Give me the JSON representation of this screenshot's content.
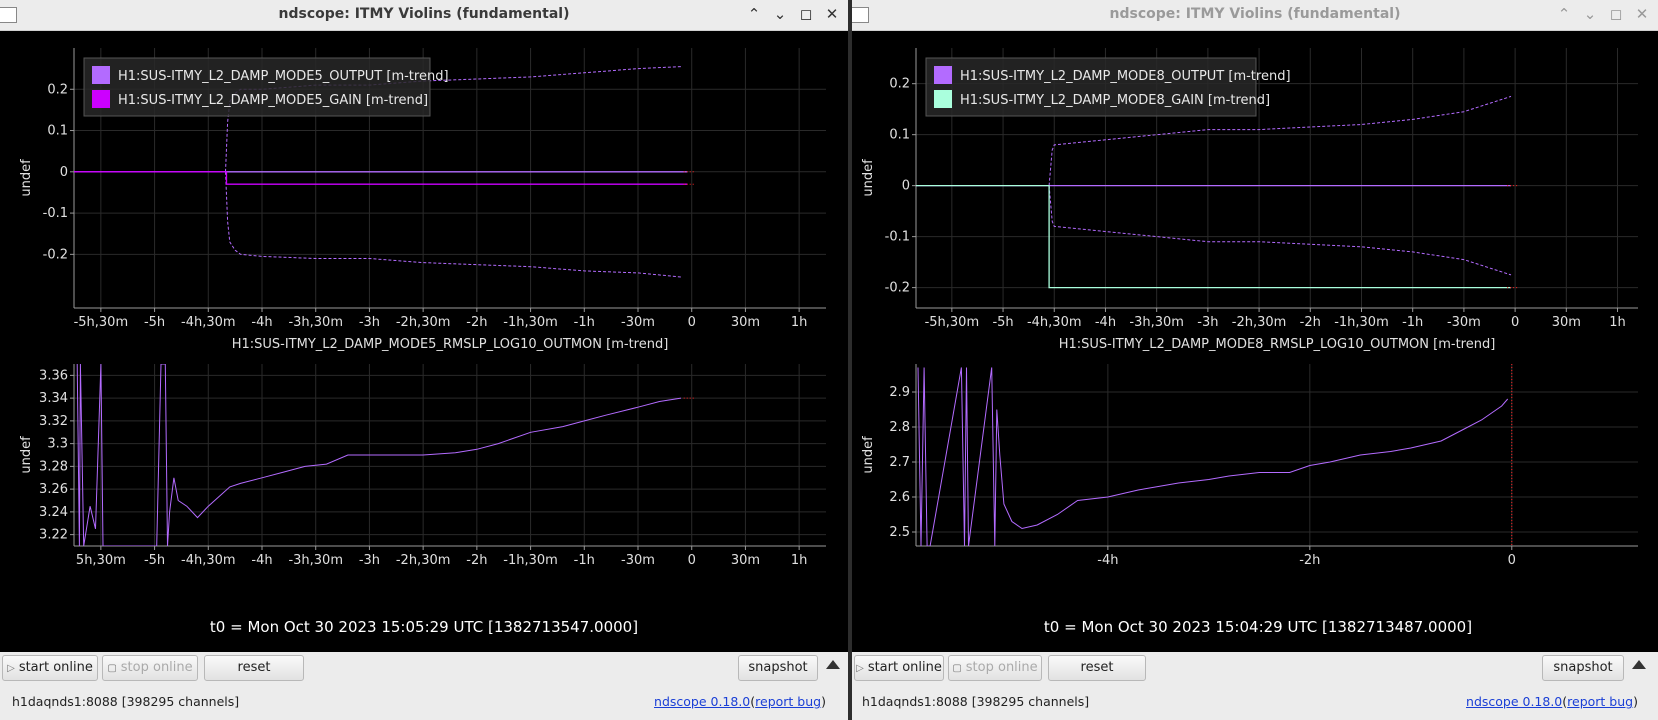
{
  "windows": [
    {
      "title": "ndscope: ITMY Violins (fundamental)",
      "t0": "t0 = Mon Oct 30 2023 15:05:29 UTC [1382713547.0000]",
      "toolbar": {
        "start_online": "start online",
        "stop_online": "stop online",
        "reset": "reset",
        "snapshot": "snapshot"
      },
      "status": {
        "host": "h1daqnds1:8088  [398295 channels]",
        "version_link": "ndscope 0.18.0",
        "paren_open": "(",
        "report_link": "report bug",
        "paren_close": ")"
      }
    },
    {
      "title": "ndscope: ITMY Violins (fundamental)",
      "t0": "t0 = Mon Oct 30 2023 15:04:29 UTC [1382713487.0000]",
      "toolbar": {
        "start_online": "start online",
        "stop_online": "stop online",
        "reset": "reset",
        "snapshot": "snapshot"
      },
      "status": {
        "host": "h1daqnds1:8088  [398295 channels]",
        "version_link": "ndscope 0.18.0",
        "paren_open": "(",
        "report_link": "report bug",
        "paren_close": ")"
      }
    }
  ],
  "colors": {
    "purple": "#cc00ff",
    "lavender": "#b36bff",
    "mint": "#aaffdd",
    "red_marker": "#ff2222",
    "grid": "#2a2a2a",
    "axis": "#9a9a9a"
  },
  "chart_data": [
    {
      "type": "line",
      "title": "",
      "ylabel": "undef",
      "xlim": [
        -5.75,
        1.25
      ],
      "ylim": [
        -0.33,
        0.3
      ],
      "xticks": [
        -5.5,
        -5,
        -4.5,
        -4,
        -3.5,
        -3,
        -2.5,
        -2,
        -1.5,
        -1,
        -0.5,
        0,
        0.5,
        1
      ],
      "xtick_labels": [
        "-5h,30m",
        "-5h",
        "-4h,30m",
        "-4h",
        "-3h,30m",
        "-3h",
        "-2h,30m",
        "-2h",
        "-1h,30m",
        "-1h",
        "-30m",
        "0",
        "30m",
        "1h"
      ],
      "yticks": [
        -0.2,
        -0.1,
        0,
        0.1,
        0.2
      ],
      "ytick_labels": [
        "-0.2",
        "-0.1",
        "0",
        "0.1",
        "0.2"
      ],
      "legend": "top-left",
      "series": [
        {
          "name": "H1:SUS-ITMY_L2_DAMP_MODE5_OUTPUT [m-trend]",
          "color": "#b36bff",
          "style": "mean",
          "x": [
            -5.75,
            -0.04
          ],
          "y": [
            0.0,
            0.0
          ]
        },
        {
          "name": "H1:SUS-ITMY_L2_DAMP_MODE5_OUTPUT [m-trend]",
          "color": "#b36bff",
          "style": "envelope-max",
          "x": [
            -4.34,
            -4.32,
            -4.3,
            -4.25,
            -4.2,
            -4.0,
            -3.5,
            -3.0,
            -2.5,
            -2.0,
            -1.5,
            -1.0,
            -0.5,
            -0.1
          ],
          "y": [
            0.0,
            0.12,
            0.17,
            0.19,
            0.2,
            0.2,
            0.21,
            0.21,
            0.22,
            0.225,
            0.23,
            0.24,
            0.25,
            0.255
          ]
        },
        {
          "name": "H1:SUS-ITMY_L2_DAMP_MODE5_OUTPUT [m-trend]",
          "color": "#b36bff",
          "style": "envelope-min",
          "x": [
            -4.34,
            -4.32,
            -4.3,
            -4.25,
            -4.2,
            -4.0,
            -3.5,
            -3.0,
            -2.5,
            -2.0,
            -1.5,
            -1.0,
            -0.5,
            -0.1
          ],
          "y": [
            0.0,
            -0.12,
            -0.17,
            -0.19,
            -0.2,
            -0.205,
            -0.21,
            -0.21,
            -0.22,
            -0.225,
            -0.23,
            -0.24,
            -0.245,
            -0.255
          ]
        },
        {
          "name": "H1:SUS-ITMY_L2_DAMP_MODE5_GAIN [m-trend]",
          "color": "#cc00ff",
          "style": "mean",
          "x": [
            -5.75,
            -4.33,
            -4.33,
            -0.04
          ],
          "y": [
            0.0,
            0.0,
            -0.03,
            -0.03
          ]
        }
      ]
    },
    {
      "type": "line",
      "title": "H1:SUS-ITMY_L2_DAMP_MODE5_RMSLP_LOG10_OUTMON [m-trend]",
      "ylabel": "undef",
      "xlim": [
        -5.75,
        1.25
      ],
      "ylim": [
        3.21,
        3.37
      ],
      "xticks": [
        -5.5,
        -5,
        -4.5,
        -4,
        -3.5,
        -3,
        -2.5,
        -2,
        -1.5,
        -1,
        -0.5,
        0,
        0.5,
        1
      ],
      "xtick_labels": [
        "5h,30m",
        "-5h",
        "-4h,30m",
        "-4h",
        "-3h,30m",
        "-3h",
        "-2h,30m",
        "-2h",
        "-1h,30m",
        "-1h",
        "-30m",
        "0",
        "30m",
        "1h"
      ],
      "yticks": [
        3.22,
        3.24,
        3.26,
        3.28,
        3.3,
        3.32,
        3.34,
        3.36
      ],
      "ytick_labels": [
        "3.22",
        "3.24",
        "3.26",
        "3.28",
        "3.3",
        "3.32",
        "3.34",
        "3.36"
      ],
      "series": [
        {
          "name": "H1:SUS-ITMY_L2_DAMP_MODE5_RMSLP_LOG10_OUTMON [m-trend]",
          "color": "#b36bff",
          "x": [
            -5.72,
            -5.7,
            -5.69,
            -5.66,
            -5.6,
            -5.55,
            -5.5,
            -5.48,
            -4.98,
            -4.94,
            -4.9,
            -4.88,
            -4.86,
            -4.82,
            -4.78,
            -4.7,
            -4.6,
            -4.5,
            -4.3,
            -4.2,
            -4.0,
            -3.8,
            -3.6,
            -3.4,
            -3.2,
            -3.0,
            -2.8,
            -2.5,
            -2.2,
            -2.0,
            -1.8,
            -1.5,
            -1.2,
            -1.0,
            -0.8,
            -0.5,
            -0.3,
            -0.1
          ],
          "y": [
            3.37,
            3.21,
            3.37,
            3.21,
            3.245,
            3.225,
            3.37,
            3.21,
            3.21,
            3.37,
            3.37,
            3.21,
            3.24,
            3.27,
            3.25,
            3.245,
            3.235,
            3.245,
            3.262,
            3.265,
            3.27,
            3.275,
            3.28,
            3.282,
            3.29,
            3.29,
            3.29,
            3.29,
            3.292,
            3.295,
            3.3,
            3.31,
            3.315,
            3.32,
            3.325,
            3.332,
            3.337,
            3.34
          ]
        }
      ]
    },
    {
      "type": "line",
      "title": "",
      "ylabel": "undef",
      "xlim": [
        -5.85,
        1.2
      ],
      "ylim": [
        -0.24,
        0.27
      ],
      "xticks": [
        -5.5,
        -5,
        -4.5,
        -4,
        -3.5,
        -3,
        -2.5,
        -2,
        -1.5,
        -1,
        -0.5,
        0,
        0.5,
        1
      ],
      "xtick_labels": [
        "-5h,30m",
        "-5h",
        "-4h,30m",
        "-4h",
        "-3h,30m",
        "-3h",
        "-2h,30m",
        "-2h",
        "-1h,30m",
        "-1h",
        "-30m",
        "0",
        "30m",
        "1h"
      ],
      "yticks": [
        -0.2,
        -0.1,
        0,
        0.1,
        0.2
      ],
      "ytick_labels": [
        "-0.2",
        "-0.1",
        "0",
        "0.1",
        "0.2"
      ],
      "legend": "top-left",
      "series": [
        {
          "name": "H1:SUS-ITMY_L2_DAMP_MODE8_OUTPUT [m-trend]",
          "color": "#b36bff",
          "style": "mean",
          "x": [
            -5.85,
            -0.04
          ],
          "y": [
            0.0,
            0.0
          ]
        },
        {
          "name": "H1:SUS-ITMY_L2_DAMP_MODE8_OUTPUT [m-trend]",
          "color": "#b36bff",
          "style": "envelope-max",
          "x": [
            -4.55,
            -4.52,
            -4.5,
            -4.0,
            -3.5,
            -3.0,
            -2.5,
            -2.0,
            -1.5,
            -1.0,
            -0.5,
            -0.04
          ],
          "y": [
            0.0,
            0.07,
            0.08,
            0.09,
            0.1,
            0.11,
            0.11,
            0.115,
            0.12,
            0.13,
            0.145,
            0.175
          ]
        },
        {
          "name": "H1:SUS-ITMY_L2_DAMP_MODE8_OUTPUT [m-trend]",
          "color": "#b36bff",
          "style": "envelope-min",
          "x": [
            -4.55,
            -4.52,
            -4.5,
            -4.0,
            -3.5,
            -3.0,
            -2.5,
            -2.0,
            -1.5,
            -1.0,
            -0.5,
            -0.04
          ],
          "y": [
            0.0,
            -0.07,
            -0.08,
            -0.09,
            -0.1,
            -0.11,
            -0.11,
            -0.115,
            -0.12,
            -0.13,
            -0.145,
            -0.175
          ]
        },
        {
          "name": "H1:SUS-ITMY_L2_DAMP_MODE8_GAIN [m-trend]",
          "color": "#aaffdd",
          "style": "mean",
          "x": [
            -5.85,
            -4.55,
            -4.55,
            -0.04
          ],
          "y": [
            0.0,
            0.0,
            -0.2,
            -0.2
          ]
        }
      ]
    },
    {
      "type": "line",
      "title": "H1:SUS-ITMY_L2_DAMP_MODE8_RMSLP_LOG10_OUTMON [m-trend]",
      "ylabel": "undef",
      "xlim": [
        -5.9,
        1.25
      ],
      "ylim": [
        2.46,
        2.98
      ],
      "xticks": [
        -4,
        -2,
        0
      ],
      "xtick_labels": [
        "-4h",
        "-2h",
        "0"
      ],
      "yticks": [
        2.5,
        2.6,
        2.7,
        2.8,
        2.9
      ],
      "ytick_labels": [
        "2.5",
        "2.6",
        "2.7",
        "2.8",
        "2.9"
      ],
      "series": [
        {
          "name": "H1:SUS-ITMY_L2_DAMP_MODE8_RMSLP_LOG10_OUTMON [m-trend]",
          "color": "#b36bff",
          "x": [
            -5.88,
            -5.85,
            -5.82,
            -5.79,
            -5.76,
            -5.45,
            -5.42,
            -5.4,
            -5.38,
            -5.15,
            -5.12,
            -5.1,
            -5.07,
            -5.03,
            -4.95,
            -4.85,
            -4.7,
            -4.5,
            -4.3,
            -4.0,
            -3.7,
            -3.5,
            -3.3,
            -3.0,
            -2.8,
            -2.5,
            -2.2,
            -2.0,
            -1.8,
            -1.5,
            -1.2,
            -1.0,
            -0.7,
            -0.5,
            -0.3,
            -0.1,
            -0.04
          ],
          "y": [
            2.97,
            2.46,
            2.97,
            2.46,
            2.46,
            2.97,
            2.46,
            2.97,
            2.46,
            2.97,
            2.46,
            2.85,
            2.72,
            2.58,
            2.53,
            2.51,
            2.52,
            2.55,
            2.59,
            2.6,
            2.62,
            2.63,
            2.64,
            2.65,
            2.66,
            2.67,
            2.67,
            2.69,
            2.7,
            2.72,
            2.73,
            2.74,
            2.76,
            2.79,
            2.82,
            2.86,
            2.88
          ]
        }
      ]
    }
  ]
}
